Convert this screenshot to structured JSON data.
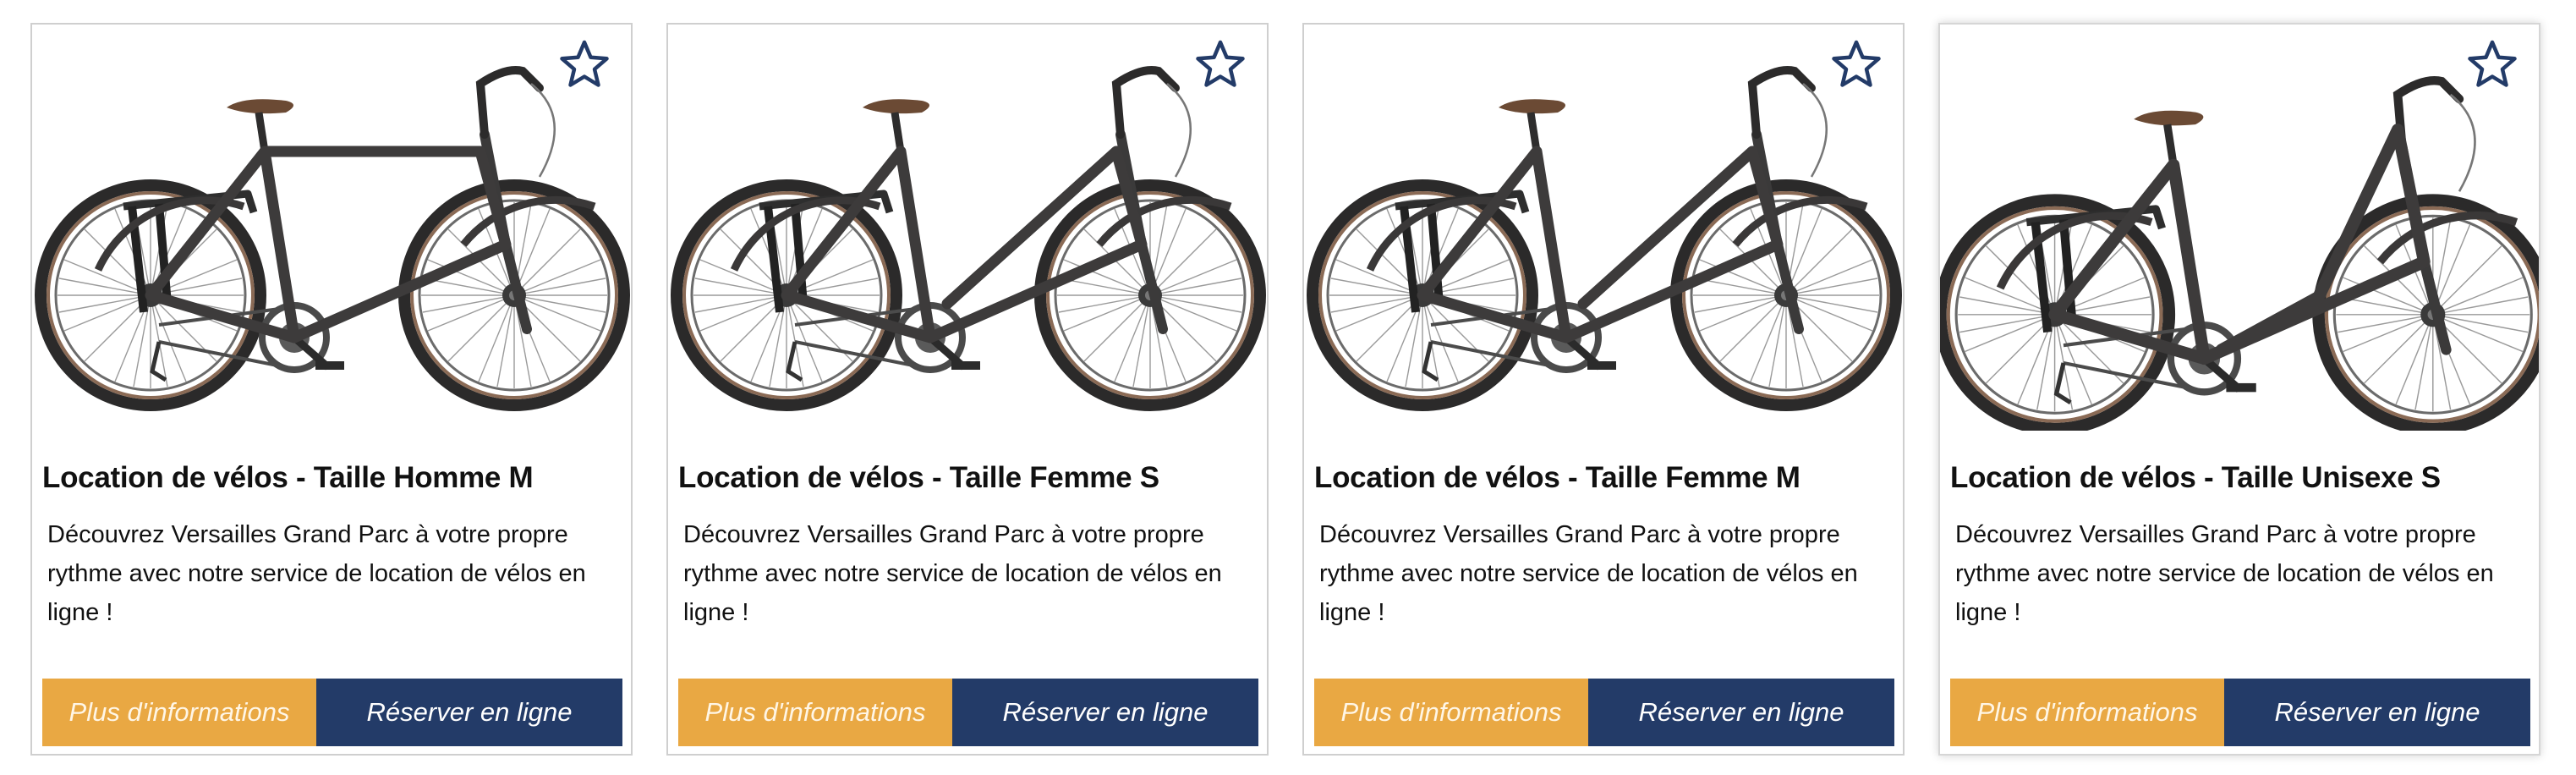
{
  "colors": {
    "info_button": "#e9a843",
    "book_button": "#233b68",
    "star_outline": "#233b68",
    "card_border": "#cfcfcf"
  },
  "products": [
    {
      "title": "Location de vélos - Taille Homme M",
      "description": "Découvrez Versailles Grand Parc à votre propre rythme avec notre service de location de vélos en ligne !",
      "info_label": "Plus d'informations",
      "book_label": "Réserver en ligne",
      "frame": "diamond",
      "favorite_icon": "star-outline-icon"
    },
    {
      "title": "Location de vélos - Taille Femme S",
      "description": "Découvrez Versailles Grand Parc à votre propre rythme avec notre service de location de vélos en ligne !",
      "info_label": "Plus d'informations",
      "book_label": "Réserver en ligne",
      "frame": "step-through",
      "favorite_icon": "star-outline-icon"
    },
    {
      "title": "Location de vélos - Taille Femme M",
      "description": "Découvrez Versailles Grand Parc à votre propre rythme avec notre service de location de vélos en ligne !",
      "info_label": "Plus d'informations",
      "book_label": "Réserver en ligne",
      "frame": "step-through",
      "favorite_icon": "star-outline-icon"
    },
    {
      "title": "Location de vélos - Taille Unisexe S",
      "description": "Découvrez Versailles Grand Parc à votre propre rythme avec notre service de location de vélos en ligne !",
      "info_label": "Plus d'informations",
      "book_label": "Réserver en ligne",
      "frame": "low-step",
      "favorite_icon": "star-outline-icon"
    }
  ]
}
